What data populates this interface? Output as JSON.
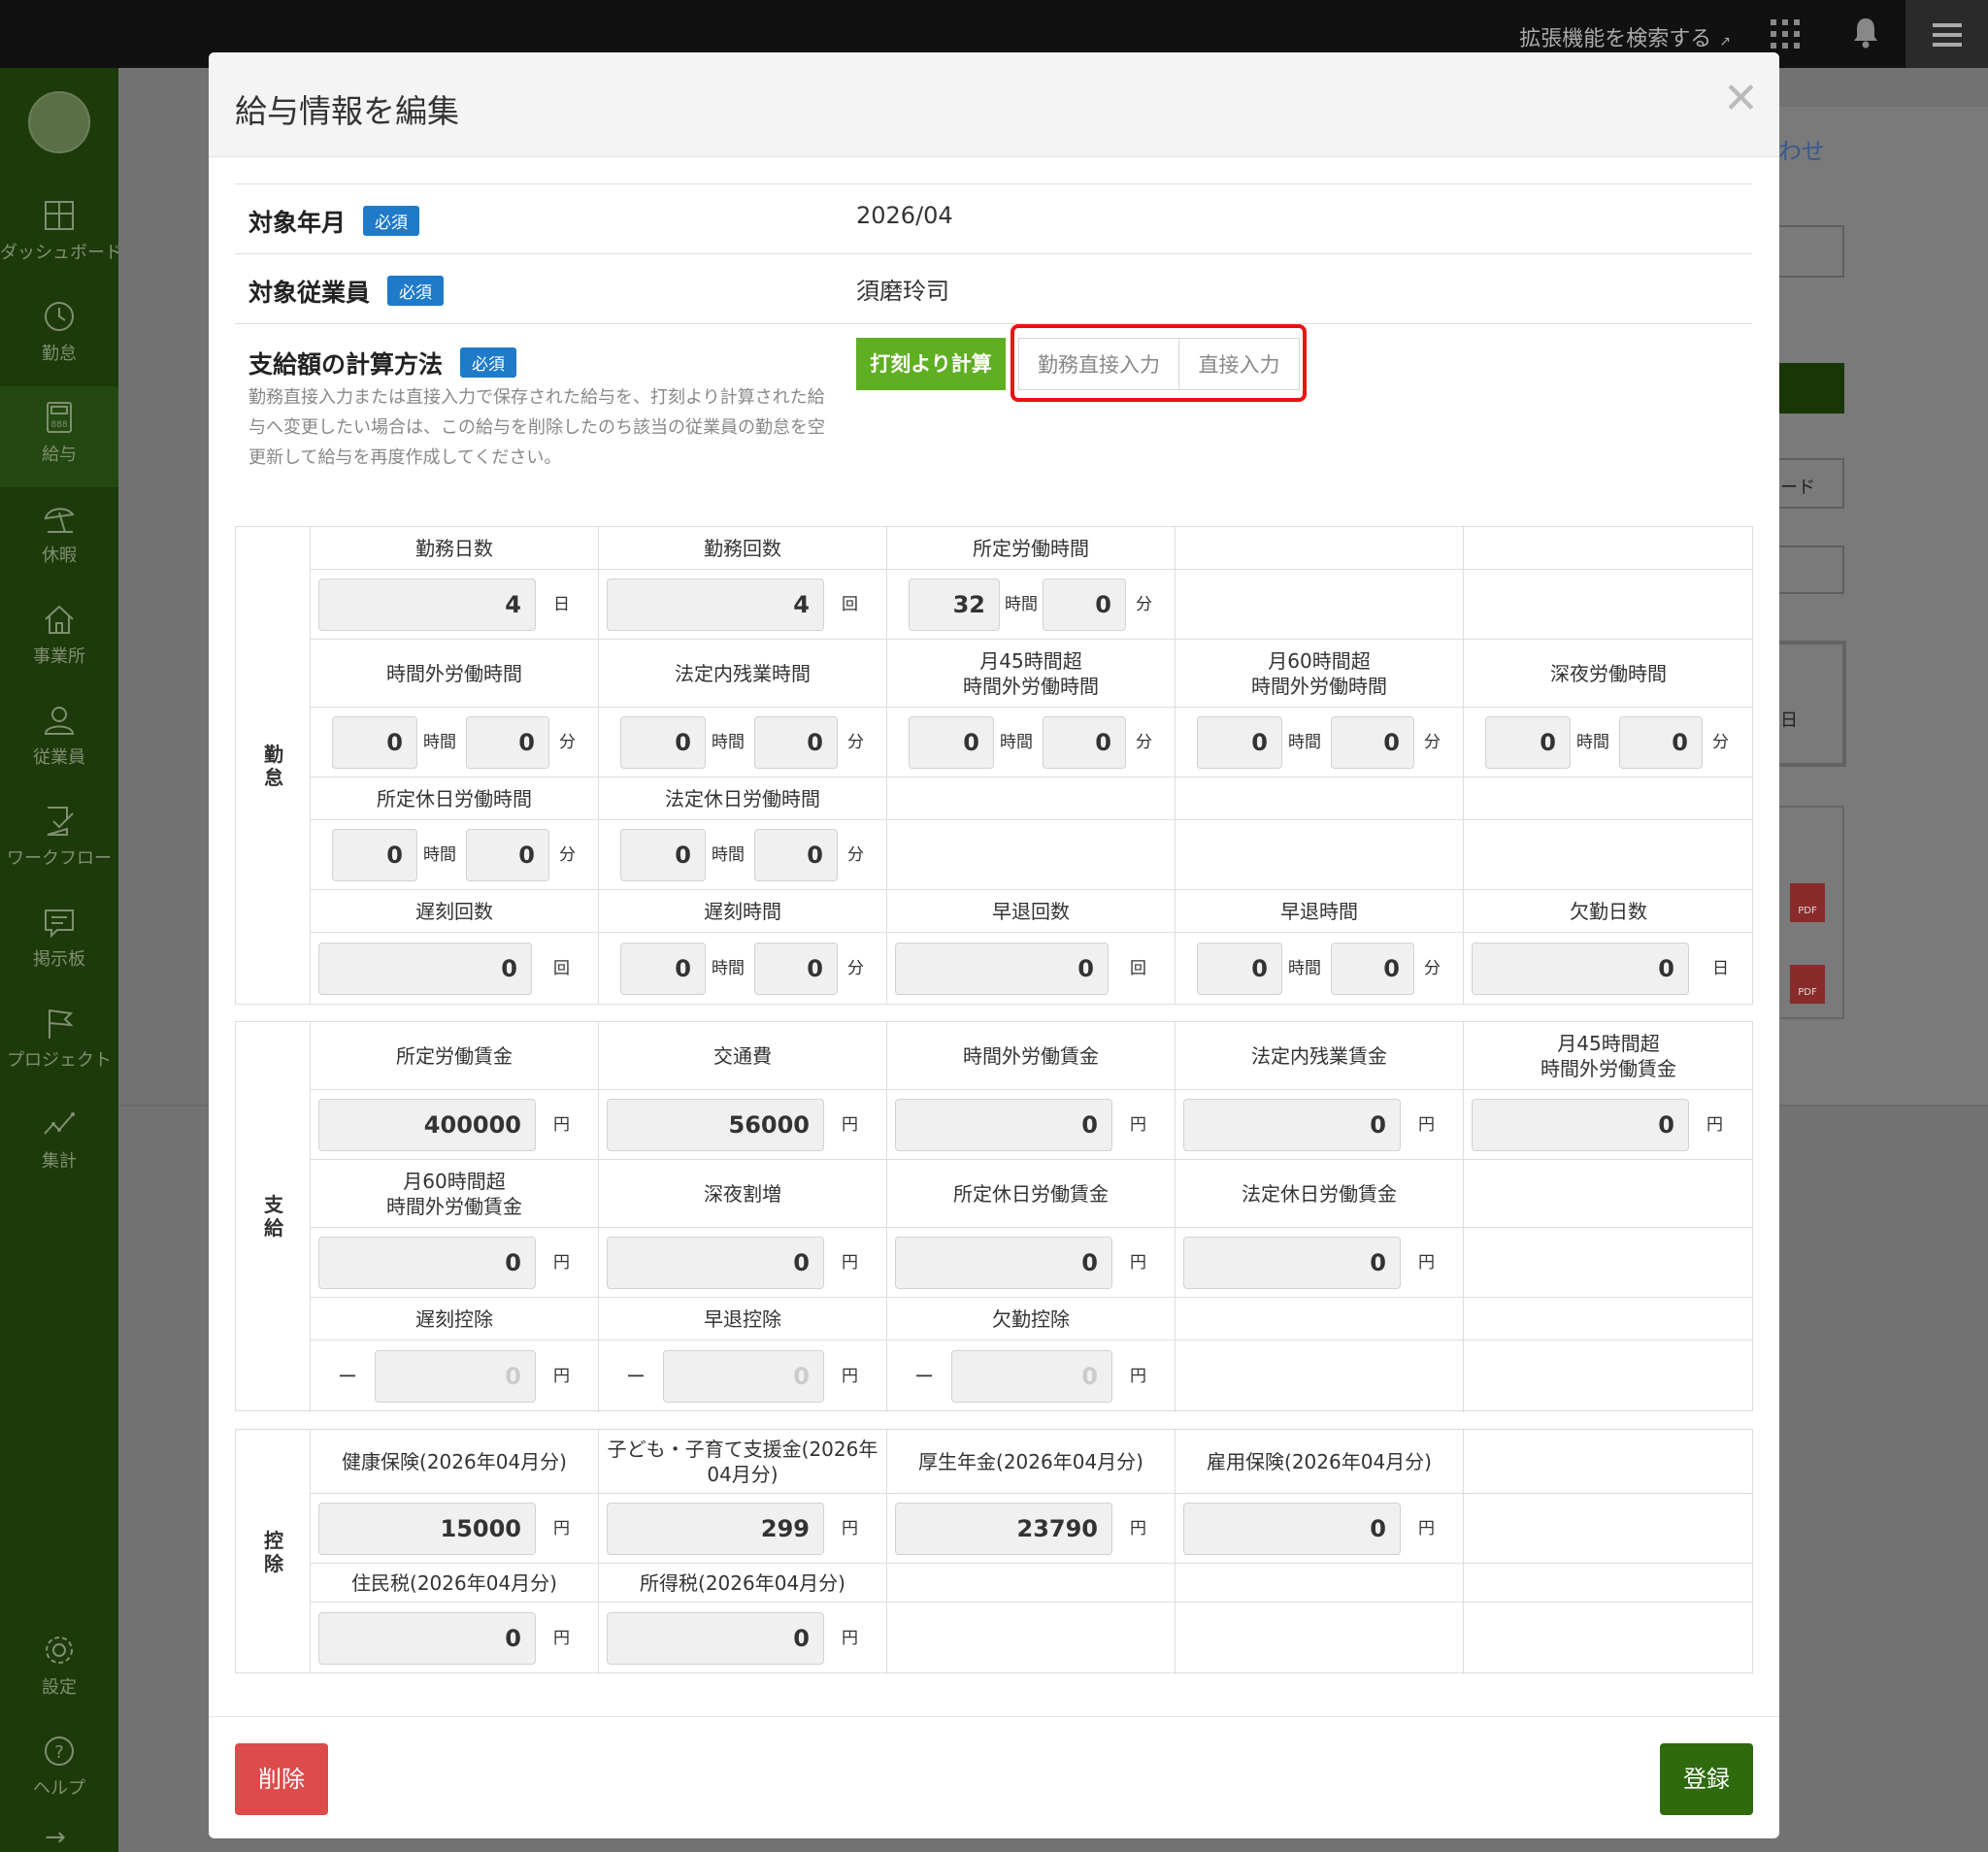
{
  "topbar": {
    "extension_search": "拡張機能を検索する"
  },
  "sidebar": {
    "items": [
      {
        "label": "ダッシュボード",
        "icon": "dashboard-icon"
      },
      {
        "label": "勤怠",
        "icon": "clock-icon"
      },
      {
        "label": "給与",
        "icon": "calculator-icon"
      },
      {
        "label": "休暇",
        "icon": "beach-umbrella-icon"
      },
      {
        "label": "事業所",
        "icon": "home-icon"
      },
      {
        "label": "従業員",
        "icon": "person-icon"
      },
      {
        "label": "ワークフロー",
        "icon": "checklist-icon"
      },
      {
        "label": "掲示板",
        "icon": "chat-icon"
      },
      {
        "label": "プロジェクト",
        "icon": "flag-icon"
      },
      {
        "label": "集計",
        "icon": "line-chart-icon"
      }
    ],
    "bottom": [
      {
        "label": "設定",
        "icon": "gear-icon"
      },
      {
        "label": "ヘルプ",
        "icon": "question-icon"
      }
    ]
  },
  "background": {
    "link_fragment": "わせ",
    "box_fragment": "ード",
    "cell_fragment": "日"
  },
  "modal": {
    "title": "給与情報を編集",
    "required_badge": "必須",
    "target_month": {
      "label": "対象年月",
      "value": "2026/04"
    },
    "target_employee": {
      "label": "対象従業員",
      "value": "須磨玲司"
    },
    "calc_method": {
      "label": "支給額の計算方法",
      "note": "勤務直接入力または直接入力で保存された給与を、打刻より計算された給与へ変更したい場合は、この給与を削除したのち該当の従業員の勤怠を空更新して給与を再度作成してください。",
      "options": [
        "打刻より計算",
        "勤務直接入力",
        "直接入力"
      ],
      "selected": "打刻より計算"
    },
    "sections": {
      "attendance": "勤怠",
      "payment": "支給",
      "deduction": "控除"
    },
    "attendance": {
      "h1": [
        "勤務日数",
        "勤務回数",
        "所定労働時間"
      ],
      "workdays": "4",
      "worktimes": "4",
      "scheduled_hours": "32",
      "scheduled_min": "0",
      "h2": [
        "時間外労働時間",
        "法定内残業時間",
        "月45時間超\n時間外労働時間",
        "月60時間超\n時間外労働時間",
        "深夜労働時間"
      ],
      "r2": [
        [
          "0",
          "0"
        ],
        [
          "0",
          "0"
        ],
        [
          "0",
          "0"
        ],
        [
          "0",
          "0"
        ],
        [
          "0",
          "0"
        ]
      ],
      "h3": [
        "所定休日労働時間",
        "法定休日労働時間"
      ],
      "r3": [
        [
          "0",
          "0"
        ],
        [
          "0",
          "0"
        ]
      ],
      "h4": [
        "遅刻回数",
        "遅刻時間",
        "早退回数",
        "早退時間",
        "欠勤日数"
      ],
      "late_count": "0",
      "late_time": [
        "0",
        "0"
      ],
      "early_count": "0",
      "early_time": [
        "0",
        "0"
      ],
      "absent_days": "0"
    },
    "payment": {
      "h1": [
        "所定労働賃金",
        "交通費",
        "時間外労働賃金",
        "法定内残業賃金",
        "月45時間超\n時間外労働賃金"
      ],
      "r1": [
        "400000",
        "56000",
        "0",
        "0",
        "0"
      ],
      "h2": [
        "月60時間超\n時間外労働賃金",
        "深夜割増",
        "所定休日労働賃金",
        "法定休日労働賃金"
      ],
      "r2": [
        "0",
        "0",
        "0",
        "0"
      ],
      "h3": [
        "遅刻控除",
        "早退控除",
        "欠勤控除"
      ],
      "r3": [
        "0",
        "0",
        "0"
      ]
    },
    "deduction": {
      "h1": [
        "健康保険(2026年04月分)",
        "子ども・子育て支援金(2026年\n04月分)",
        "厚生年金(2026年04月分)",
        "雇用保険(2026年04月分)"
      ],
      "r1": [
        "15000",
        "299",
        "23790",
        "0"
      ],
      "h2": [
        "住民税(2026年04月分)",
        "所得税(2026年04月分)"
      ],
      "r2": [
        "0",
        "0"
      ]
    },
    "units": {
      "day": "日",
      "times": "回",
      "hour": "時間",
      "minute": "分",
      "yen": "円",
      "minus": "ー"
    },
    "buttons": {
      "delete": "削除",
      "register": "登録"
    }
  },
  "colors": {
    "accent_green": "#5faf22",
    "register_green": "#2f6b0d",
    "delete_red": "#dd4b4b",
    "badge_blue": "#1f7ac9",
    "highlight_red": "#ee1111"
  }
}
